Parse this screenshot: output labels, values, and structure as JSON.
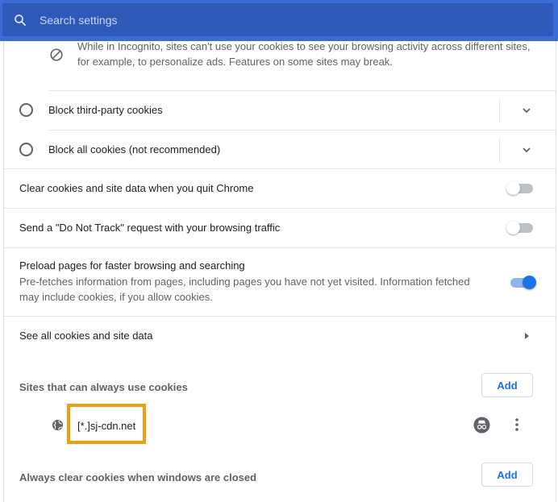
{
  "search": {
    "placeholder": "Search settings"
  },
  "incognito_note": {
    "line1": "While in Incognito, sites can't use your cookies to see your browsing activity across different sites,",
    "line2": "for example, to personalize ads. Features on some sites may break."
  },
  "options": {
    "block_third_party": "Block third-party cookies",
    "block_all": "Block all cookies (not recommended)"
  },
  "toggles": {
    "clear_on_quit": {
      "label": "Clear cookies and site data when you quit Chrome",
      "on": false
    },
    "do_not_track": {
      "label": "Send a \"Do Not Track\" request with your browsing traffic",
      "on": false
    },
    "preload": {
      "label": "Preload pages for faster browsing and searching",
      "desc_line1": "Pre-fetches information from pages, including pages you have not yet visited. Information fetched",
      "desc_line2": "may include cookies, if you allow cookies.",
      "on": true
    }
  },
  "see_all": {
    "label": "See all cookies and site data"
  },
  "sites_allow": {
    "heading": "Sites that can always use cookies",
    "add_label": "Add",
    "sites": [
      {
        "name": "[*.]sj-cdn.net"
      }
    ]
  },
  "sites_clear": {
    "heading": "Always clear cookies when windows are closed",
    "add_label": "Add"
  },
  "colors": {
    "accent": "#1a73e8",
    "toggle_on_track": "#8fb3ee",
    "toggle_on_knob": "#1a73e8",
    "highlight_border": "#f39c12"
  }
}
